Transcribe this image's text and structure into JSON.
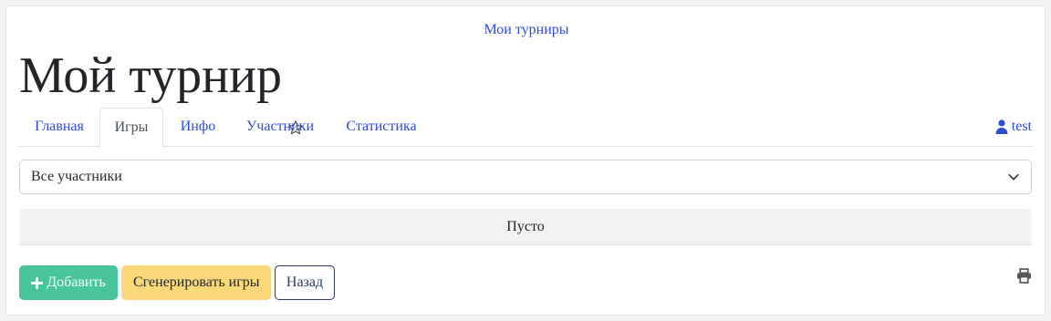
{
  "header": {
    "my_tournaments_link": "Мои турниры",
    "title": "Мой турнир"
  },
  "tabs": [
    {
      "label": "Главная",
      "active": false
    },
    {
      "label": "Игры",
      "active": true
    },
    {
      "label": "Инфо",
      "active": false
    },
    {
      "label": "Участники",
      "active": false
    },
    {
      "label": "Статистика",
      "active": false
    }
  ],
  "user": {
    "name": "test",
    "icon": "user-icon"
  },
  "filter": {
    "selected": "Все участники"
  },
  "games_table": {
    "empty_text": "Пусто"
  },
  "actions": {
    "add_label": "Добавить",
    "generate_label": "Сгенерировать игры",
    "back_label": "Назад"
  },
  "colors": {
    "link": "#2f4bd6",
    "add_button": "#48c49a",
    "generate_button": "#fbd87a",
    "back_button_border": "#2d3a5a"
  }
}
